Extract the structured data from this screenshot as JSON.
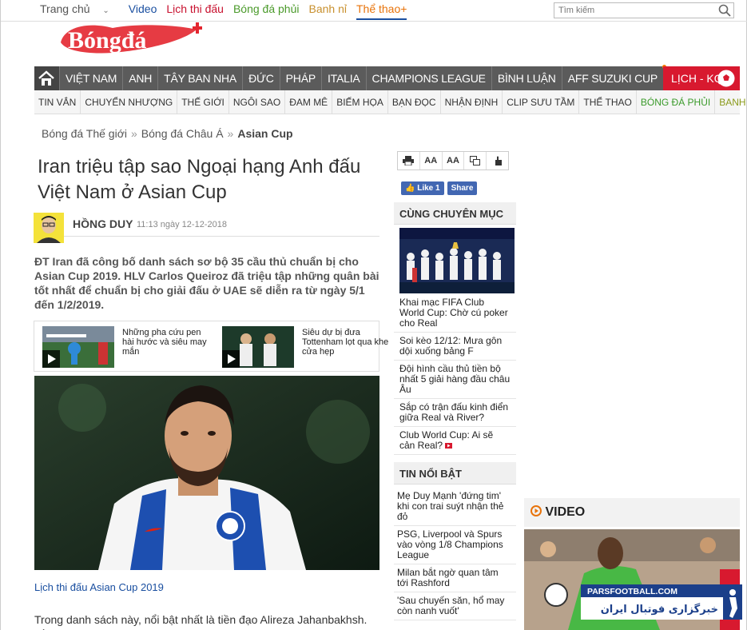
{
  "topbar": {
    "home": "Trang chủ",
    "video": "Video",
    "schedule": "Lịch thi đấu",
    "bdp": "Bóng đá phủi",
    "banhni": "Banh nỉ",
    "thethao": "Thể thao+",
    "search_placeholder": "Tìm kiếm"
  },
  "logo": {
    "text": "Bóngđá"
  },
  "mainnav": [
    "VIỆT NAM",
    "ANH",
    "TÂY BAN NHA",
    "ĐỨC",
    "PHÁP",
    "ITALIA",
    "CHAMPIONS LEAGUE",
    "BÌNH LUẬN",
    "AFF SUZUKI CUP"
  ],
  "live_label": "LỊCH - KQ",
  "subnav": [
    "TIN VẮN",
    "CHUYỂN NHƯỢNG",
    "THẾ GIỚI",
    "NGÔI SAO",
    "ĐAM MÊ",
    "BIẾM HỌA",
    "BẠN ĐỌC",
    "NHẬN ĐỊNH",
    "CLIP SƯU TẦM",
    "THỂ THAO"
  ],
  "subnav_green": "BÓNG ĐÁ PHỦI",
  "subnav_olive": "BANH NỈ",
  "breadcrumb": [
    "Bóng đá Thế giới",
    "Bóng đá Châu Á",
    "Asian Cup"
  ],
  "article": {
    "title": "Iran triệu tập sao Ngoại hạng Anh đấu Việt Nam ở Asian Cup",
    "author": "HỒNG DUY",
    "time": "11:13 ngày 12-12-2018",
    "sapo": "ĐT Iran đã công bố danh sách sơ bộ 35 cầu thủ chuẩn bị cho Asian Cup 2019. HLV Carlos Queiroz đã triệu tập những quân bài tốt nhất để chuẩn bị cho giải đấu ở UAE sẽ diễn ra từ ngày 5/1 đến 1/2/2019.",
    "related": [
      "Những pha cứu pen hài hước và siêu may mắn",
      "Siêu dự bị đưa Tottenham lọt qua khe cửa hẹp"
    ],
    "caption": "Lịch thi đấu Asian Cup 2019",
    "body": "Trong danh sách này, nổi bật nhất là tiền đạo Alireza Jahanbakhsh. Cầu"
  },
  "tools": [
    "AA",
    "AA"
  ],
  "fb": {
    "like": "Like 1",
    "share": "Share"
  },
  "sidebar": {
    "same_cat_title": "CÙNG CHUYÊN MỤC",
    "same_cat": [
      "Khai mạc FIFA Club World Cup: Chờ cú poker cho Real",
      "Soi kèo 12/12: Mưa gôn dội xuống bảng F",
      "Đội hình cầu thủ tiền bộ nhất 5 giải hàng đầu châu Âu",
      "Sắp có trận đấu kinh điển giữa Real và River?",
      "Club World Cup: Ai sẽ cản Real?"
    ],
    "hot_title": "TIN NỔI BẬT",
    "hot": [
      "Mẹ Duy Mạnh 'đứng tim' khi con trai suýt nhận thẻ đỏ",
      "PSG, Liverpool và Spurs vào vòng 1/8 Champions League",
      "Milan bắt ngờ quan tâm tới Rashford",
      "'Sau chuyến săn, hổ may còn nanh vuốt'"
    ]
  },
  "video": {
    "title": "VIDEO"
  },
  "watermark": {
    "site": "PARSFOOTBALL.COM",
    "persian": "خبرگزاری فوتبال ایران"
  }
}
